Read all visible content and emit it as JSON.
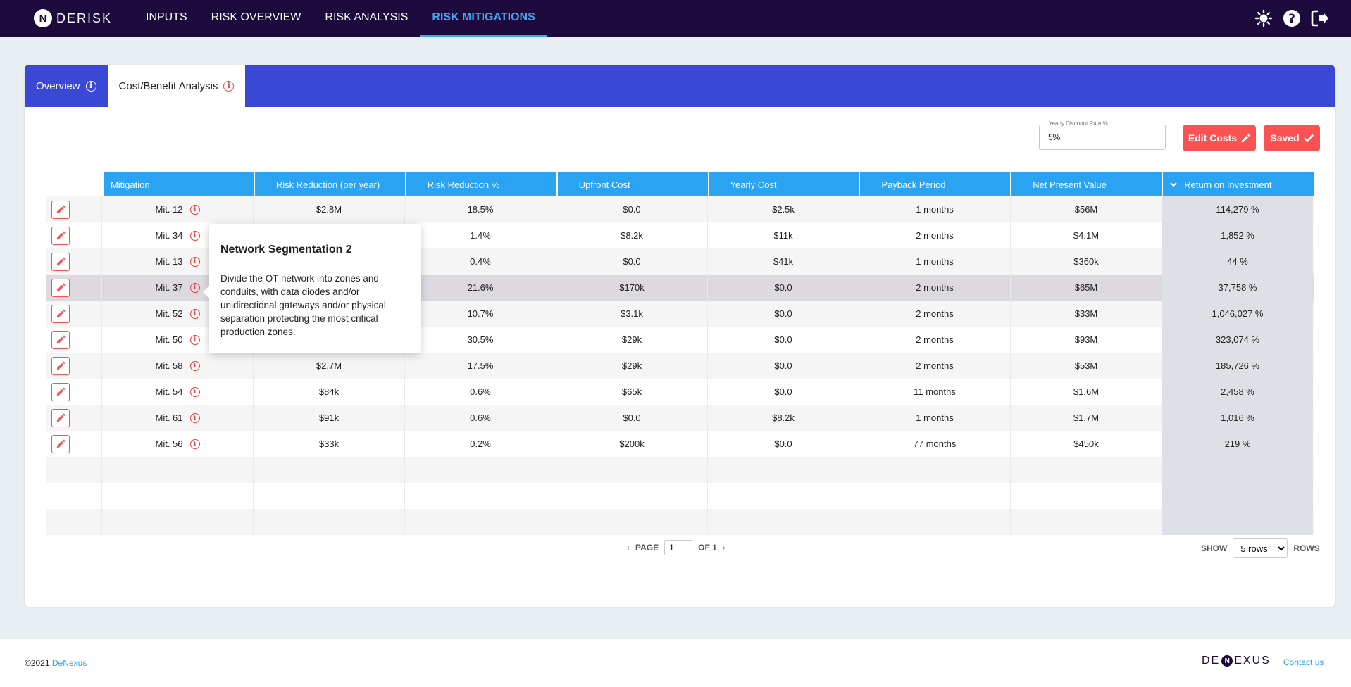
{
  "app": {
    "logo_text": "DERISK",
    "logo_mark": "N"
  },
  "nav": [
    {
      "label": "INPUTS",
      "active": false
    },
    {
      "label": "RISK OVERVIEW",
      "active": false
    },
    {
      "label": "RISK ANALYSIS",
      "active": false
    },
    {
      "label": "RISK MITIGATIONS",
      "active": true
    }
  ],
  "top_icons": [
    "settings-sun-icon",
    "help-icon",
    "logout-icon"
  ],
  "tabs": [
    {
      "label": "Overview",
      "active": false
    },
    {
      "label": "Cost/Benefit Analysis",
      "active": true
    }
  ],
  "controls": {
    "discount_label": "Yearly Discount Rate %",
    "discount_value": "5%",
    "edit_costs_label": "Edit Costs",
    "saved_label": "Saved"
  },
  "table": {
    "columns": [
      "Mitigation",
      "Risk Reduction (per year)",
      "Risk Reduction %",
      "Upfront Cost",
      "Yearly Cost",
      "Payback Period",
      "Net Present Value",
      "Return on Investment"
    ],
    "sorted_column": "Return on Investment",
    "rows": [
      [
        "Mit. 12",
        "$2.8M",
        "18.5%",
        "$0.0",
        "$2.5k",
        "1 months",
        "$56M",
        "114,279 %"
      ],
      [
        "Mit. 34",
        "",
        "1.4%",
        "$8.2k",
        "$11k",
        "2 months",
        "$4.1M",
        "1,852 %"
      ],
      [
        "Mit. 13",
        "",
        "0.4%",
        "$0.0",
        "$41k",
        "1 months",
        "$360k",
        "44 %"
      ],
      [
        "Mit. 37",
        "",
        "21.6%",
        "$170k",
        "$0.0",
        "2 months",
        "$65M",
        "37,758 %"
      ],
      [
        "Mit. 52",
        "",
        "10.7%",
        "$3.1k",
        "$0.0",
        "2 months",
        "$33M",
        "1,046,027 %"
      ],
      [
        "Mit. 50",
        "",
        "30.5%",
        "$29k",
        "$0.0",
        "2 months",
        "$93M",
        "323,074 %"
      ],
      [
        "Mit. 58",
        "$2.7M",
        "17.5%",
        "$29k",
        "$0.0",
        "2 months",
        "$53M",
        "185,726 %"
      ],
      [
        "Mit. 54",
        "$84k",
        "0.6%",
        "$65k",
        "$0.0",
        "11 months",
        "$1.6M",
        "2,458 %"
      ],
      [
        "Mit. 61",
        "$91k",
        "0.6%",
        "$0.0",
        "$8.2k",
        "1 months",
        "$1.7M",
        "1,016 %"
      ],
      [
        "Mit. 56",
        "$33k",
        "0.2%",
        "$200k",
        "$0.0",
        "77 months",
        "$450k",
        "219 %"
      ]
    ],
    "hover_row": 3,
    "empty_rows": 3
  },
  "pager": {
    "page_label": "PAGE",
    "page_value": "1",
    "of_label": "OF 1",
    "show_label": "SHOW",
    "rows_option": "5 rows",
    "rows_label": "ROWS"
  },
  "tooltip": {
    "title": "Network Segmentation 2",
    "body": "Divide the OT network into zones and conduits, with data diodes and/or unidirectional gateways and/or physical separation protecting the most critical production zones."
  },
  "footer": {
    "copyright": "©2021",
    "company_link": "DeNexus",
    "logo_text_a": "DE",
    "logo_mark": "N",
    "logo_text_b": "EXUS",
    "contact": "Contact us"
  },
  "colors": {
    "nav_bg": "#1c0a3d",
    "accent_blue": "#29a3f2",
    "tab_bar": "#3b48d6",
    "danger": "#fa5252"
  }
}
